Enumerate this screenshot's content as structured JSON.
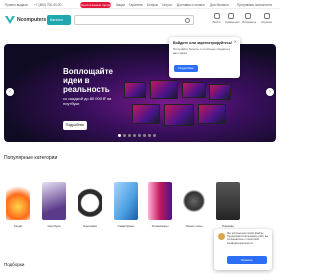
{
  "topbar": {
    "link1": "Пункты выдачи",
    "phone": "+7 (800) 700-00-00",
    "promo": "Акции в вашем городе",
    "nav": [
      "Акции",
      "Гарантия",
      "Бонусы",
      "Услуги",
      "Доставка и оплата",
      "Для бизнеса"
    ],
    "loyalty": "Программа лояльности"
  },
  "header": {
    "logo_text": "Ncomputers",
    "catalog_label": "Каталог",
    "search_placeholder": "",
    "icons": [
      {
        "name": "user-icon",
        "label": "Войти"
      },
      {
        "name": "compare-icon",
        "label": "Сравнение"
      },
      {
        "name": "heart-icon",
        "label": "Избранное"
      },
      {
        "name": "cart-icon",
        "label": "Корзина"
      }
    ]
  },
  "banner": {
    "title": "Воплощайте идеи в реальность",
    "subtitle": "со скидкой до 80 000 ₽ на ноутбуки",
    "button": "Подробнее",
    "prev": "‹",
    "next": "›"
  },
  "popup": {
    "title": "Войдите или зарегистрируйтесь!",
    "text": "Получайте бонусы и отличные скидки на ваш заказ",
    "button": "Подробнее",
    "close": "✕"
  },
  "categories": {
    "title": "Популярные категории",
    "items": [
      {
        "label": "Акции",
        "color": "#ff6b1a"
      },
      {
        "label": "Ноутбуки",
        "color": "#5a3a8a"
      },
      {
        "label": "Наушники",
        "color": "#2b2b2b"
      },
      {
        "label": "Смартфоны",
        "color": "#4a9fe0"
      },
      {
        "label": "Телевизоры",
        "color": "#c2185b"
      },
      {
        "label": "Умные часы",
        "color": "#333333"
      },
      {
        "label": "Рюкзаки",
        "color": "#3a3a3a"
      }
    ]
  },
  "picks_title": "Подборки",
  "cookie": {
    "text": "Мы используем cookie-файлы. Продолжая использовать сайт, вы соглашаетесь с политикой конфиденциальности",
    "button": "Принять"
  }
}
